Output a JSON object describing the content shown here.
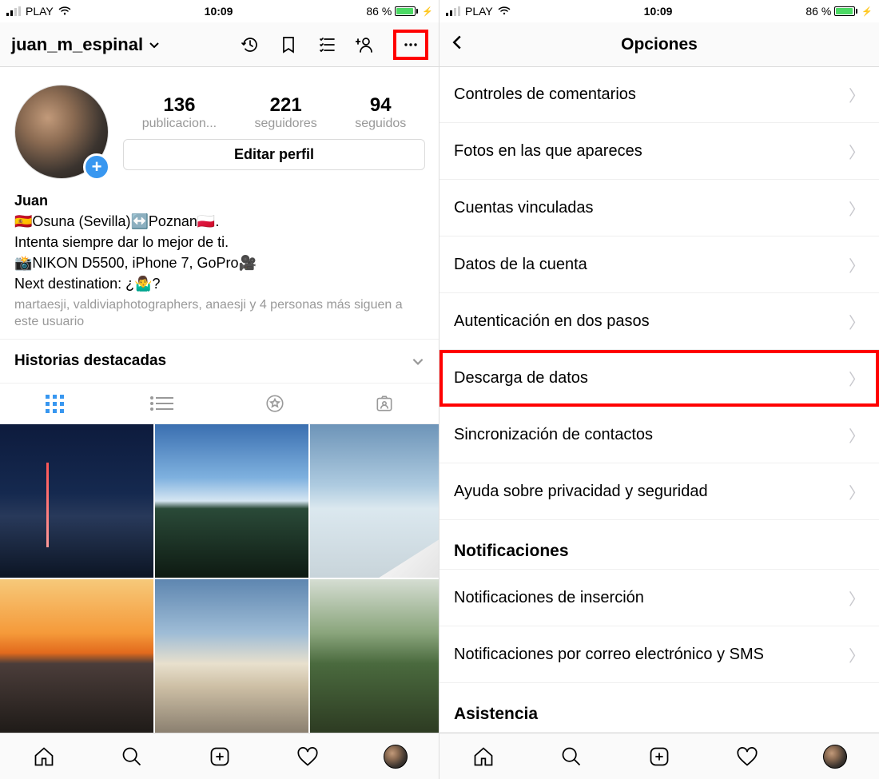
{
  "statusbar": {
    "carrier": "PLAY",
    "time": "10:09",
    "battery_pct": "86 %"
  },
  "left": {
    "username": "juan_m_espinal",
    "stats": {
      "posts_count": "136",
      "posts_label": "publicacion...",
      "followers_count": "221",
      "followers_label": "seguidores",
      "following_count": "94",
      "following_label": "seguidos"
    },
    "edit_profile": "Editar perfil",
    "bio": {
      "name": "Juan",
      "line1": "🇪🇸Osuna (Sevilla)↔️Poznan🇵🇱.",
      "line2": "Intenta siempre dar lo mejor de ti.",
      "line3": "📸NIKON D5500, iPhone 7, GoPro🎥",
      "line4": "Next destination: ¿🤷‍♂️?",
      "followed_by": "martaesji, valdiviaphotographers, anaesji y 4 personas más siguen a este usuario"
    },
    "highlights_title": "Historias destacadas"
  },
  "right": {
    "title": "Opciones",
    "items": [
      "Controles de comentarios",
      "Fotos en las que apareces",
      "Cuentas vinculadas",
      "Datos de la cuenta",
      "Autenticación en dos pasos",
      "Descarga de datos",
      "Sincronización de contactos",
      "Ayuda sobre privacidad y seguridad"
    ],
    "section_notifications": "Notificaciones",
    "notif_items": [
      "Notificaciones de inserción",
      "Notificaciones por correo electrónico y SMS"
    ],
    "section_assistance": "Asistencia"
  }
}
